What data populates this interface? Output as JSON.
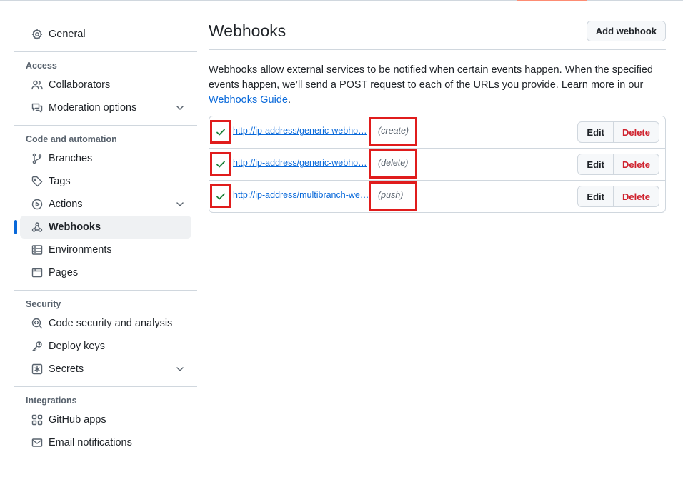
{
  "sidebar": {
    "general": "General",
    "sections": [
      {
        "heading": "Access",
        "items": [
          {
            "label": "Collaborators",
            "icon": "people-icon"
          },
          {
            "label": "Moderation options",
            "icon": "comment-discussion-icon",
            "expandable": true
          }
        ]
      },
      {
        "heading": "Code and automation",
        "items": [
          {
            "label": "Branches",
            "icon": "git-branch-icon"
          },
          {
            "label": "Tags",
            "icon": "tag-icon"
          },
          {
            "label": "Actions",
            "icon": "play-icon",
            "expandable": true
          },
          {
            "label": "Webhooks",
            "icon": "webhook-icon",
            "active": true
          },
          {
            "label": "Environments",
            "icon": "server-icon"
          },
          {
            "label": "Pages",
            "icon": "browser-icon"
          }
        ]
      },
      {
        "heading": "Security",
        "items": [
          {
            "label": "Code security and analysis",
            "icon": "codescan-icon"
          },
          {
            "label": "Deploy keys",
            "icon": "key-icon"
          },
          {
            "label": "Secrets",
            "icon": "key-asterisk-icon",
            "expandable": true
          }
        ]
      },
      {
        "heading": "Integrations",
        "items": [
          {
            "label": "GitHub apps",
            "icon": "apps-icon"
          },
          {
            "label": "Email notifications",
            "icon": "mail-icon"
          }
        ]
      }
    ]
  },
  "main": {
    "title": "Webhooks",
    "add_button": "Add webhook",
    "intro_text": "Webhooks allow external services to be notified when certain events happen. When the specified events happen, we’ll send a POST request to each of the URLs you provide. Learn more in our ",
    "intro_link": "Webhooks Guide",
    "intro_end": ".",
    "hooks": [
      {
        "url": "http://ip-address/generic-webhook-trigger/invoke",
        "url_display": "http://ip-address/generic-webho…",
        "event": "(create)",
        "edit": "Edit",
        "delete": "Delete"
      },
      {
        "url": "http://ip-address/generic-webhook-trigger/invoke",
        "url_display": "http://ip-address/generic-webho…",
        "event": "(delete)",
        "edit": "Edit",
        "delete": "Delete"
      },
      {
        "url": "http://ip-address/multibranch-webhook-trigger/invoke",
        "url_display": "http://ip-address/multibranch-we…",
        "event": "(push)",
        "edit": "Edit",
        "delete": "Delete"
      }
    ]
  },
  "colors": {
    "accent": "#0969da",
    "success": "#1a7f37",
    "danger": "#cf222e",
    "highlight": "#e01c1c"
  }
}
